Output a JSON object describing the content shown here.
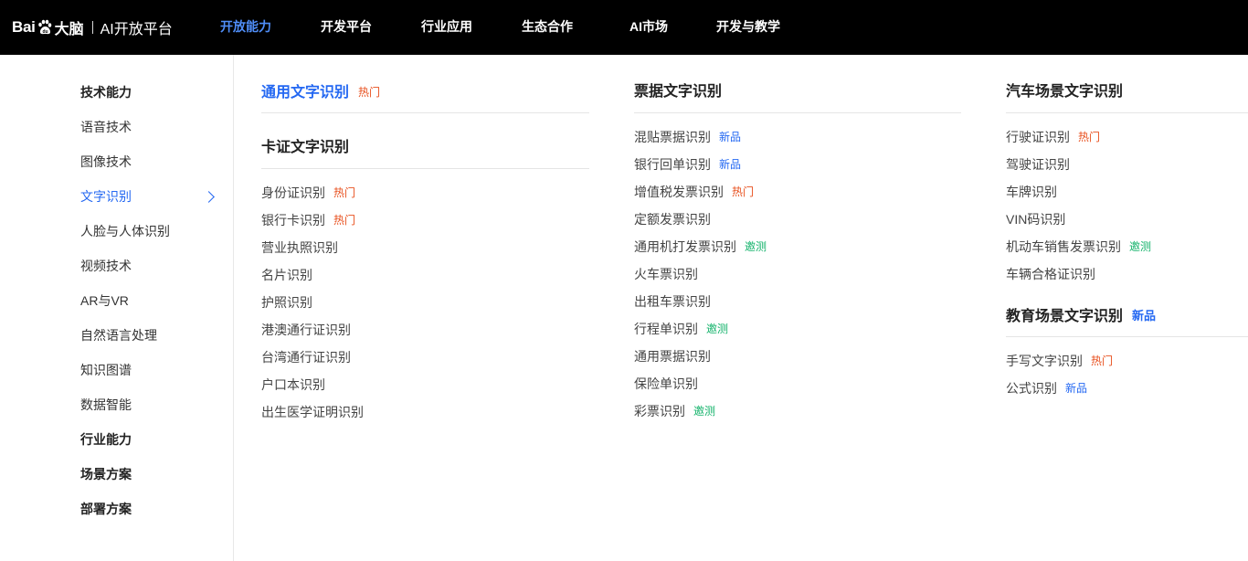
{
  "brand": {
    "part1": "Bai",
    "part2": "大脑",
    "platform": "AI开放平台"
  },
  "nav": [
    {
      "label": "开放能力",
      "active": true
    },
    {
      "label": "开发平台"
    },
    {
      "label": "行业应用"
    },
    {
      "label": "生态合作"
    },
    {
      "label": "AI市场"
    },
    {
      "label": "开发与教学"
    }
  ],
  "sidebar": [
    {
      "label": "技术能力",
      "bold": true
    },
    {
      "label": "语音技术"
    },
    {
      "label": "图像技术"
    },
    {
      "label": "文字识别",
      "active": true
    },
    {
      "label": "人脸与人体识别"
    },
    {
      "label": "视频技术"
    },
    {
      "label": "AR与VR"
    },
    {
      "label": "自然语言处理"
    },
    {
      "label": "知识图谱"
    },
    {
      "label": "数据智能"
    },
    {
      "label": "行业能力",
      "bold": true
    },
    {
      "label": "场景方案",
      "bold": true
    },
    {
      "label": "部署方案",
      "bold": true
    }
  ],
  "tags": {
    "hot": "热门",
    "new": "新品",
    "invite": "邀测"
  },
  "columns": {
    "general": {
      "title": "通用文字识别",
      "tag": "热门"
    },
    "cards": {
      "title": "卡证文字识别",
      "items": [
        {
          "label": "身份证识别",
          "tag": "热门"
        },
        {
          "label": "银行卡识别",
          "tag": "热门"
        },
        {
          "label": "营业执照识别"
        },
        {
          "label": "名片识别"
        },
        {
          "label": "护照识别"
        },
        {
          "label": "港澳通行证识别"
        },
        {
          "label": "台湾通行证识别"
        },
        {
          "label": "户口本识别"
        },
        {
          "label": "出生医学证明识别"
        }
      ]
    },
    "bills": {
      "title": "票据文字识别",
      "items": [
        {
          "label": "混贴票据识别",
          "tag": "新品"
        },
        {
          "label": "银行回单识别",
          "tag": "新品"
        },
        {
          "label": "增值税发票识别",
          "tag": "热门"
        },
        {
          "label": "定额发票识别"
        },
        {
          "label": "通用机打发票识别",
          "tag": "邀测"
        },
        {
          "label": "火车票识别"
        },
        {
          "label": "出租车票识别"
        },
        {
          "label": "行程单识别",
          "tag": "邀测"
        },
        {
          "label": "通用票据识别"
        },
        {
          "label": "保险单识别"
        },
        {
          "label": "彩票识别",
          "tag": "邀测"
        }
      ]
    },
    "car": {
      "title": "汽车场景文字识别",
      "items": [
        {
          "label": "行驶证识别",
          "tag": "热门"
        },
        {
          "label": "驾驶证识别"
        },
        {
          "label": "车牌识别"
        },
        {
          "label": "VIN码识别"
        },
        {
          "label": "机动车销售发票识别",
          "tag": "邀测"
        },
        {
          "label": "车辆合格证识别"
        }
      ]
    },
    "edu": {
      "title": "教育场景文字识别",
      "tag": "新品",
      "items": [
        {
          "label": "手写文字识别",
          "tag": "热门"
        },
        {
          "label": "公式识别",
          "tag": "新品"
        }
      ]
    }
  },
  "colors": {
    "accent": "#2468f2",
    "nav_active": "#4f8df7",
    "hot": "#e8501e",
    "invite": "#14b36b"
  }
}
